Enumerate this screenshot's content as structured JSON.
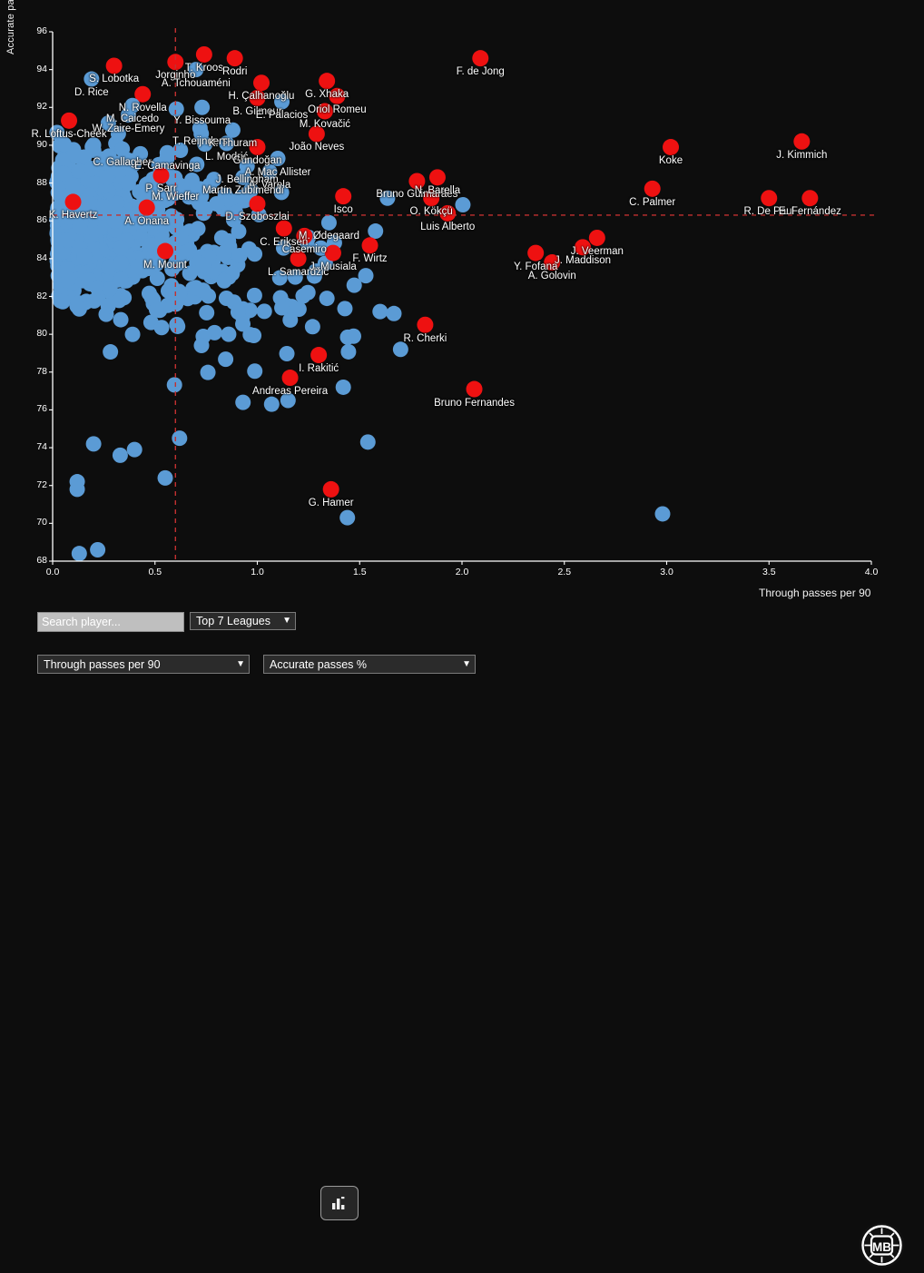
{
  "chart_data": {
    "type": "scatter",
    "title": "",
    "xlabel": "Through passes per 90",
    "ylabel": "Accurate passes %",
    "xlim": [
      0.0,
      4.0
    ],
    "ylim": [
      68,
      96
    ],
    "xticks": [
      "0.0",
      "0.5",
      "1.0",
      "1.5",
      "2.0",
      "2.5",
      "3.0",
      "3.5",
      "4.0"
    ],
    "xtick_values": [
      0.0,
      0.5,
      1.0,
      1.5,
      2.0,
      2.5,
      3.0,
      3.5,
      4.0
    ],
    "yticks": [
      "96",
      "94",
      "92",
      "90",
      "88",
      "86",
      "84",
      "82",
      "80",
      "78",
      "76",
      "74",
      "72",
      "70",
      "68"
    ],
    "ytick_values": [
      96,
      94,
      92,
      90,
      88,
      86,
      84,
      82,
      80,
      78,
      76,
      74,
      72,
      70,
      68
    ],
    "grid": false,
    "legend": "none",
    "colors": {
      "background": "#0d0d0d",
      "highlight_point": "#ee1111",
      "normal_point": "#5b9bd5",
      "axis": "#ffffff",
      "reference_line": "#c23030",
      "label_text": "#ffffff"
    },
    "reference_lines": {
      "vertical_x": 0.6,
      "horizontal_y": 86.3
    },
    "labeled_points": [
      {
        "name": "S. Lobotka",
        "x": 0.3,
        "y": 94.2,
        "highlight": true
      },
      {
        "name": "D. Rice",
        "x": 0.19,
        "y": 93.5,
        "highlight": false
      },
      {
        "name": "N. Rovella",
        "x": 0.44,
        "y": 92.7,
        "highlight": true
      },
      {
        "name": "M. Caicedo",
        "x": 0.39,
        "y": 92.1,
        "highlight": false
      },
      {
        "name": "W. Zaire-Emery",
        "x": 0.37,
        "y": 91.6,
        "highlight": false
      },
      {
        "name": "R. Loftus-Cheek",
        "x": 0.08,
        "y": 91.3,
        "highlight": true
      },
      {
        "name": "C. Gallagher",
        "x": 0.34,
        "y": 89.8,
        "highlight": false
      },
      {
        "name": "E. Camavinga",
        "x": 0.56,
        "y": 89.6,
        "highlight": false
      },
      {
        "name": "P. Sarr",
        "x": 0.53,
        "y": 88.4,
        "highlight": true
      },
      {
        "name": "M. Wieffer",
        "x": 0.6,
        "y": 88.0,
        "highlight": false
      },
      {
        "name": "K. Havertz",
        "x": 0.1,
        "y": 87.0,
        "highlight": true
      },
      {
        "name": "A. Onana",
        "x": 0.46,
        "y": 86.7,
        "highlight": true
      },
      {
        "name": "M. Mount",
        "x": 0.55,
        "y": 84.4,
        "highlight": true
      },
      {
        "name": "Jorginho",
        "x": 0.6,
        "y": 94.4,
        "highlight": true
      },
      {
        "name": "T. Kroos",
        "x": 0.74,
        "y": 94.8,
        "highlight": true
      },
      {
        "name": "Rodri",
        "x": 0.89,
        "y": 94.6,
        "highlight": true
      },
      {
        "name": "A. Tchouaméni",
        "x": 0.7,
        "y": 94.0,
        "highlight": false
      },
      {
        "name": "Y. Bissouma",
        "x": 0.73,
        "y": 92.0,
        "highlight": false
      },
      {
        "name": "T. Reijnders",
        "x": 0.72,
        "y": 90.9,
        "highlight": false
      },
      {
        "name": "K. Thuram",
        "x": 0.88,
        "y": 90.8,
        "highlight": false
      },
      {
        "name": "L. Modrić",
        "x": 0.85,
        "y": 90.1,
        "highlight": false
      },
      {
        "name": "Gündoğan",
        "x": 1.0,
        "y": 89.9,
        "highlight": true
      },
      {
        "name": "J. Bellingham",
        "x": 0.95,
        "y": 88.9,
        "highlight": false
      },
      {
        "name": "A. Varela",
        "x": 1.06,
        "y": 88.6,
        "highlight": false
      },
      {
        "name": "Martín Zubimendi",
        "x": 0.93,
        "y": 88.3,
        "highlight": false
      },
      {
        "name": "A. Mac Allister",
        "x": 1.1,
        "y": 89.3,
        "highlight": false
      },
      {
        "name": "H. Çalhanoğlu",
        "x": 1.02,
        "y": 93.3,
        "highlight": true
      },
      {
        "name": "B. Gilmour",
        "x": 1.0,
        "y": 92.5,
        "highlight": true
      },
      {
        "name": "E. Palacios",
        "x": 1.12,
        "y": 92.3,
        "highlight": false
      },
      {
        "name": "G. Xhaka",
        "x": 1.34,
        "y": 93.4,
        "highlight": true
      },
      {
        "name": "Oriol Romeu",
        "x": 1.39,
        "y": 92.6,
        "highlight": true
      },
      {
        "name": "M. Kovačić",
        "x": 1.33,
        "y": 91.8,
        "highlight": true
      },
      {
        "name": "João Neves",
        "x": 1.29,
        "y": 90.6,
        "highlight": true
      },
      {
        "name": "D. Szoboszlai",
        "x": 1.0,
        "y": 86.9,
        "highlight": true
      },
      {
        "name": "C. Eriksen",
        "x": 1.13,
        "y": 85.6,
        "highlight": true
      },
      {
        "name": "Casemiro",
        "x": 1.23,
        "y": 85.2,
        "highlight": true
      },
      {
        "name": "L. Samardžić",
        "x": 1.2,
        "y": 84.0,
        "highlight": true
      },
      {
        "name": "Isco",
        "x": 1.42,
        "y": 87.3,
        "highlight": true
      },
      {
        "name": "M. Ødegaard",
        "x": 1.35,
        "y": 85.9,
        "highlight": false
      },
      {
        "name": "J. Musiala",
        "x": 1.37,
        "y": 84.3,
        "highlight": true
      },
      {
        "name": "F. Wirtz",
        "x": 1.55,
        "y": 84.7,
        "highlight": true
      },
      {
        "name": "Bruno Guimarães",
        "x": 1.78,
        "y": 88.1,
        "highlight": true
      },
      {
        "name": "N. Barella",
        "x": 1.88,
        "y": 88.3,
        "highlight": true
      },
      {
        "name": "O. Kökçü",
        "x": 1.85,
        "y": 87.2,
        "highlight": true
      },
      {
        "name": "Luis Alberto",
        "x": 1.93,
        "y": 86.4,
        "highlight": true
      },
      {
        "name": "F. de Jong",
        "x": 2.09,
        "y": 94.6,
        "highlight": true
      },
      {
        "name": "R. Cherki",
        "x": 1.82,
        "y": 80.5,
        "highlight": true
      },
      {
        "name": "I. Rakitić",
        "x": 1.3,
        "y": 78.9,
        "highlight": true
      },
      {
        "name": "Andreas Pereira",
        "x": 1.16,
        "y": 77.7,
        "highlight": true
      },
      {
        "name": "Bruno Fernandes",
        "x": 2.06,
        "y": 77.1,
        "highlight": true
      },
      {
        "name": "G. Hamer",
        "x": 1.36,
        "y": 71.8,
        "highlight": true
      },
      {
        "name": "Y. Fofana",
        "x": 2.36,
        "y": 84.3,
        "highlight": true
      },
      {
        "name": "A. Golovin",
        "x": 2.44,
        "y": 83.8,
        "highlight": true
      },
      {
        "name": "J. Maddison",
        "x": 2.59,
        "y": 84.6,
        "highlight": true
      },
      {
        "name": "J. Veerman",
        "x": 2.66,
        "y": 85.1,
        "highlight": true
      },
      {
        "name": "C. Palmer",
        "x": 2.93,
        "y": 87.7,
        "highlight": true
      },
      {
        "name": "Koke",
        "x": 3.02,
        "y": 89.9,
        "highlight": true
      },
      {
        "name": "J. Kimmich",
        "x": 3.66,
        "y": 90.2,
        "highlight": true
      },
      {
        "name": "R. De Paul",
        "x": 3.5,
        "y": 87.2,
        "highlight": true
      },
      {
        "name": "E. Fernández",
        "x": 3.7,
        "y": 87.2,
        "highlight": true
      }
    ]
  },
  "controls": {
    "search": {
      "placeholder": "Search player...",
      "value": ""
    },
    "league_select": {
      "value": "Top 7 Leagues",
      "options": [
        "Top 7 Leagues"
      ],
      "caret": "chevron-down-icon"
    },
    "chart_button": {
      "icon": "bar-chart-icon"
    },
    "x_metric_select": {
      "value": "Through passes per 90",
      "options": [
        "Through passes per 90"
      ],
      "caret": "chevron-down-icon"
    },
    "y_metric_select": {
      "value": "Accurate passes %",
      "options": [
        "Accurate passes %"
      ],
      "caret": "chevron-down-icon"
    }
  },
  "logo": {
    "text": "MB"
  }
}
